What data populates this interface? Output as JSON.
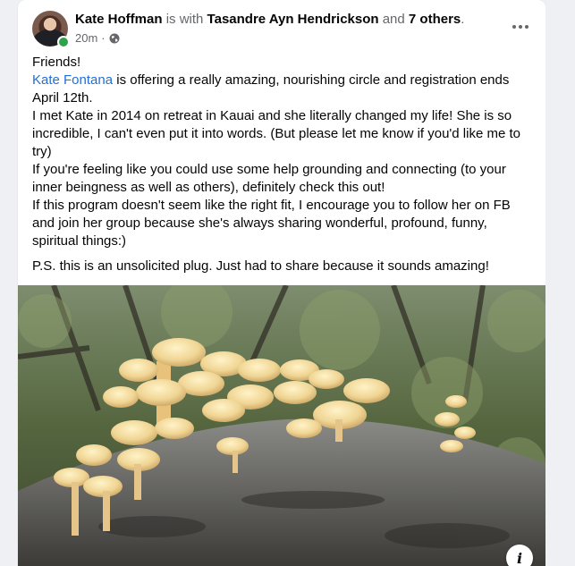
{
  "post": {
    "author": "Kate Hoffman",
    "with_text": "is with",
    "tagged": "Tasandre Ayn Hendrickson",
    "and_text": "and",
    "others": "7 others",
    "period": ".",
    "time": "20m",
    "separator": "·",
    "privacy_icon": "globe-icon",
    "more_icon": "more-options-icon",
    "paragraphs": {
      "p1": "Friends!",
      "p2_mention": "Kate Fontana",
      "p2_rest": " is offering a really amazing, nourishing circle and registration ends April 12th.",
      "p3": "I met Kate in 2014 on retreat in Kauai and she literally changed my life! She is so incredible, I can't even put it into words. (But please let me know if you'd like me to try)",
      "p4": "If you're feeling like you could use some help grounding and connecting (to your inner beingness as well as others), definitely check this out!",
      "p5": "If this program doesn't seem like the right fit, I encourage you to follow her on FB and join her group because she's always sharing wonderful, profound, funny, spiritual things:)",
      "ps": "P.S. this is an unsolicited plug. Just had to share because it sounds amazing!"
    },
    "info_label": "i"
  },
  "colors": {
    "link": "#216fdb",
    "online": "#31a24c",
    "secondary_text": "#65676b"
  }
}
